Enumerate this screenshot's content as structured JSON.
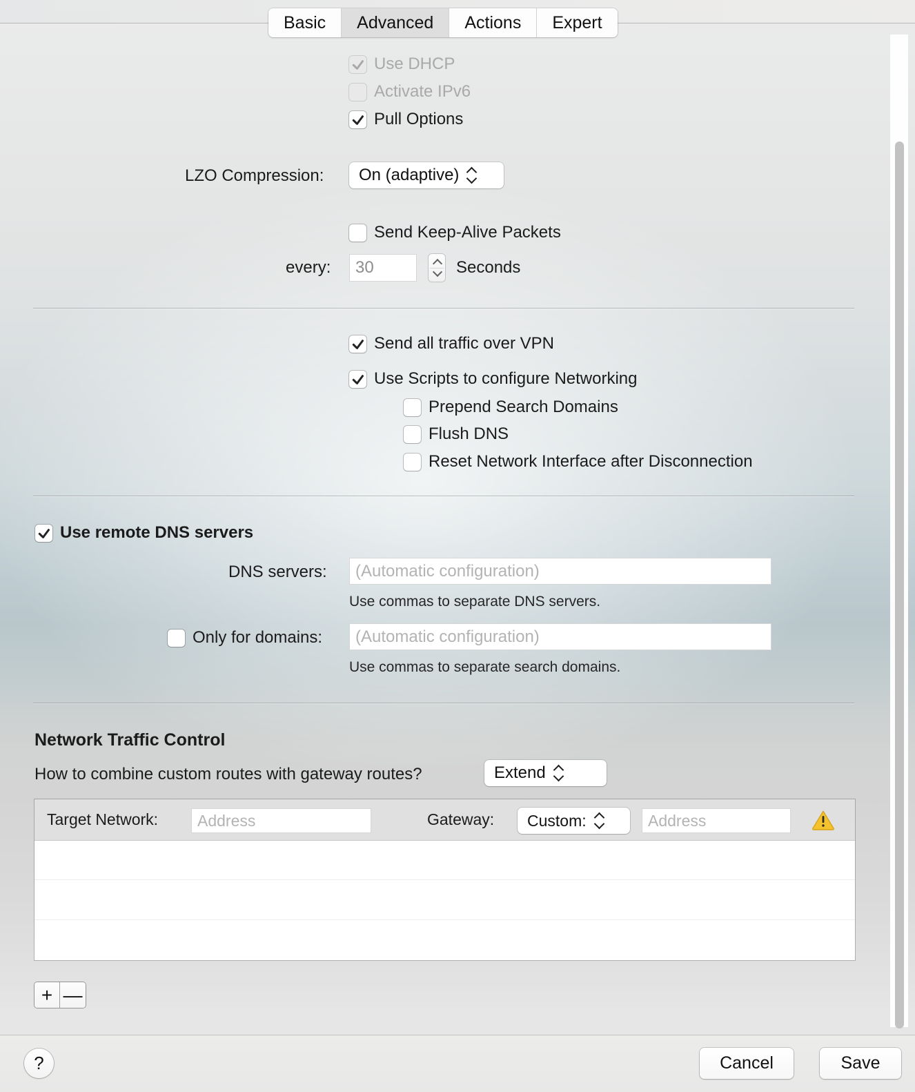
{
  "tabs": [
    {
      "label": "Basic",
      "selected": false
    },
    {
      "label": "Advanced",
      "selected": true
    },
    {
      "label": "Actions",
      "selected": false
    },
    {
      "label": "Expert",
      "selected": false
    }
  ],
  "options": {
    "use_dhcp": "Use DHCP",
    "activate_ipv6": "Activate IPv6",
    "pull_options": "Pull Options"
  },
  "compression": {
    "label": "LZO Compression:",
    "value": "On (adaptive)"
  },
  "keepalive": {
    "checkbox_label": "Send Keep-Alive Packets",
    "every_label": "every:",
    "interval_value": "30",
    "unit_label": "Seconds"
  },
  "routing": {
    "send_all_traffic": "Send all traffic over VPN",
    "use_scripts": "Use Scripts to configure Networking",
    "prepend_search_domains": "Prepend Search Domains",
    "flush_dns": "Flush DNS",
    "reset_network_interface": "Reset Network Interface after Disconnection"
  },
  "dns": {
    "section_title": "Use remote DNS servers",
    "servers_label": "DNS servers:",
    "servers_placeholder": "(Automatic configuration)",
    "servers_hint": "Use commas to separate DNS servers.",
    "domains_label": "Only for domains:",
    "domains_placeholder": "(Automatic configuration)",
    "domains_hint": "Use commas to separate search domains."
  },
  "network_traffic_control": {
    "title": "Network Traffic Control",
    "combine_question": "How to combine custom routes with gateway routes?",
    "combine_value": "Extend",
    "table": {
      "target_network_label": "Target Network:",
      "target_network_placeholder": "Address",
      "gateway_label": "Gateway:",
      "gateway_mode_value": "Custom:",
      "gateway_address_placeholder": "Address",
      "rows": [
        "",
        "",
        ""
      ]
    },
    "add_button": "+",
    "remove_button": "—"
  },
  "footer": {
    "help_label": "?",
    "cancel_label": "Cancel",
    "save_label": "Save"
  },
  "colors": {
    "warning": "#F5C034",
    "selected_tab_bg": "#DEDEDE"
  }
}
